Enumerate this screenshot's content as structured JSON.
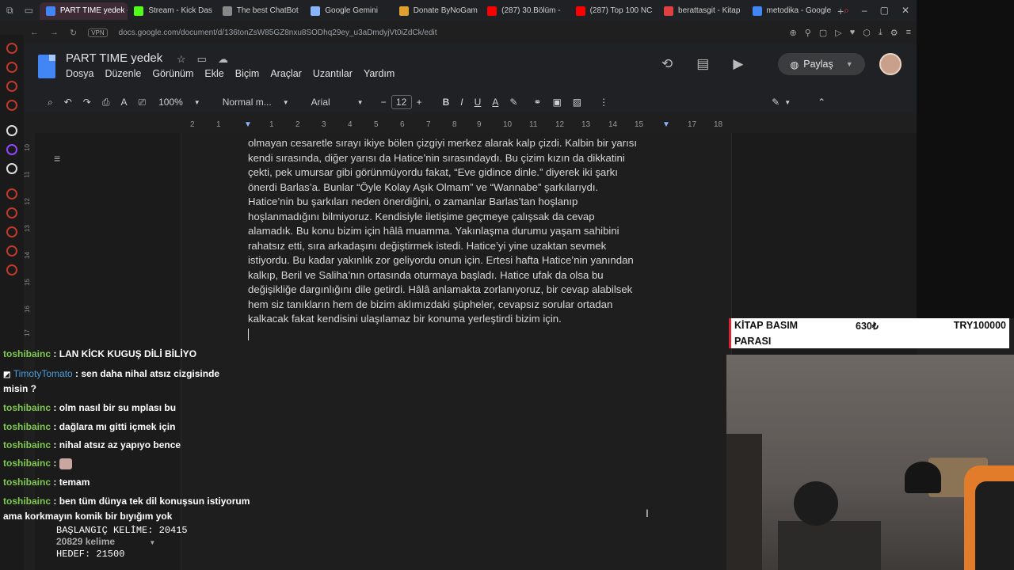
{
  "browser": {
    "tabs": [
      {
        "label": "PART TIME yedek - Goog",
        "color": "#4285f4",
        "active": true
      },
      {
        "label": "Stream - Kick Das",
        "color": "#53fc18",
        "active": false
      },
      {
        "label": "The best ChatBot",
        "color": "#888888",
        "active": false
      },
      {
        "label": "Google Gemini",
        "color": "#8ab4f8",
        "active": false
      },
      {
        "label": "Donate ByNoGam",
        "color": "#e0a030",
        "active": false
      },
      {
        "label": "(287) 30.Bölüm -",
        "color": "#ff0000",
        "active": false
      },
      {
        "label": "(287) Top 100 NC",
        "color": "#ff0000",
        "active": false
      },
      {
        "label": "berattasgit - Kitap",
        "color": "#e04040",
        "active": false
      },
      {
        "label": "metodika - Google",
        "color": "#4285f4",
        "active": false
      }
    ],
    "url": "docs.google.com/document/d/136tonZsW85GZ8nxu8SODhq29ey_u3aDmdyjVt0iZdCk/edit",
    "vpn": "VPN"
  },
  "docs": {
    "title": "PART TIME  yedek",
    "menu": [
      "Dosya",
      "Düzenle",
      "Görünüm",
      "Ekle",
      "Biçim",
      "Araçlar",
      "Uzantılar",
      "Yardım"
    ],
    "share_label": "Paylaş",
    "toolbar": {
      "zoom": "100%",
      "style": "Normal m...",
      "font": "Arial",
      "font_size": "12"
    },
    "ruler_numbers": [
      "2",
      "1",
      "1",
      "2",
      "3",
      "4",
      "5",
      "6",
      "7",
      "8",
      "9",
      "10",
      "11",
      "12",
      "13",
      "14",
      "15",
      "16",
      "17",
      "18"
    ],
    "vruler_numbers": [
      "10",
      "11",
      "12",
      "13",
      "14",
      "15",
      "16",
      "17"
    ],
    "body_lines": [
      "olmayan cesaretle sırayı ikiye bölen çizgiyi merkez alarak kalp çizdi. Kalbin bir yarısı",
      "kendi sırasında, diğer yarısı da Hatice’nin sırasındaydı. Bu çizim kızın da dikkatini",
      "çekti, pek umursar gibi görünmüyordu fakat, “Eve gidince dinle.” diyerek iki şarkı",
      "önerdi Barlas’a. Bunlar “Öyle Kolay Aşık Olmam” ve “Wannabe” şarkılarıydı.",
      "Hatice’nin bu şarkıları neden önerdiğini, o zamanlar Barlas’tan hoşlanıp",
      "hoşlanmadığını bilmiyoruz. Kendisiyle iletişime geçmeye çalışsak da cevap",
      "alamadık. Bu konu bizim için hâlâ muamma. Yakınlaşma durumu yaşam sahibini",
      "rahatsız etti, sıra arkadaşını değiştirmek istedi. Hatice’yi yine uzaktan sevmek",
      "istiyordu. Bu kadar yakınlık zor geliyordu onun için. Ertesi hafta Hatice’nin yanından",
      "kalkıp, Beril ve Saliha’nın ortasında oturmaya başladı. Hatice ufak da olsa bu",
      "değişikliğe dargınlığını dile getirdi. Hâlâ anlamakta zorlanıyoruz, bir cevap alabilsek",
      "hem siz tanıkların hem de bizim aklımızdaki şüpheler, cevapsız sorular ortadan",
      "kalkacak fakat kendisini ulaşılamaz bir konuma yerleştirdi bizim için."
    ]
  },
  "chat": {
    "messages": [
      {
        "user": "toshibainc",
        "text": ": LAN KİCK KUGUŞ DİLİ BİLİYO"
      },
      {
        "user": "TimotyTomato",
        "text": ": sen daha nihal atsız cizgisinde"
      },
      {
        "user": "",
        "text": "misin ?"
      },
      {
        "user": "toshibainc",
        "text": ": olm nasıl bir su mplası bu"
      },
      {
        "user": "toshibainc",
        "text": ": dağlara mı gitti içmek için"
      },
      {
        "user": "toshibainc",
        "text": ": nihal atsız az yapıyo bence"
      },
      {
        "user": "toshibainc",
        "text": ":"
      },
      {
        "user": "toshibainc",
        "text": ": temam"
      },
      {
        "user": "toshibainc",
        "text": ": ben tüm dünya tek dil konuşsun istiyorum"
      },
      {
        "user": "",
        "text": "ama korkmayın komik bir bıyığım yok"
      }
    ]
  },
  "stats": {
    "start": "BAŞLANGIÇ KELİME: 20415",
    "word_count": "20829 kelime",
    "target": "HEDEF: 21500"
  },
  "goal": {
    "label_line1": "KİTAP BASIM",
    "label_line2": "PARASI",
    "amount": "630₺",
    "target": "TRY100000"
  }
}
